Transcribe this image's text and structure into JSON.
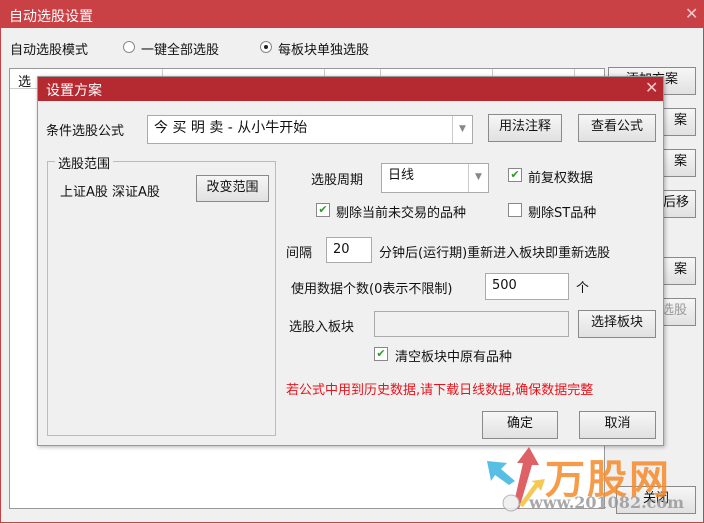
{
  "window": {
    "title": "自动选股设置",
    "close_icon": "close-icon"
  },
  "mode": {
    "label": "自动选股模式",
    "options": [
      {
        "label": "一键全部选股",
        "selected": false
      },
      {
        "label": "每板块单独选股",
        "selected": true
      }
    ]
  },
  "table": {
    "headers": [
      "选"
    ]
  },
  "side_buttons": [
    "添加方案",
    "案",
    "案",
    "后移",
    "案",
    "选股",
    "关闭"
  ],
  "dialog": {
    "title": "设置方案",
    "formula_label": "条件选股公式",
    "formula_value": "今 买 明 卖  - 从小牛开始",
    "usage_button": "用法注释",
    "view_button": "查看公式",
    "range_group": "选股范围",
    "range_value": "上证A股 深证A股",
    "change_range_button": "改变范围",
    "period_label": "选股周期",
    "period_value": "日线",
    "adjust_label": "前复权数据",
    "adjust_checked": true,
    "exclude_untraded_label": "剔除当前未交易的品种",
    "exclude_untraded_checked": true,
    "exclude_st_label": "剔除ST品种",
    "exclude_st_checked": false,
    "interval_label": "间隔",
    "interval_value": "20",
    "interval_suffix": "分钟后(运行期)重新进入板块即重新选股",
    "data_count_label": "使用数据个数(0表示不限制)",
    "data_count_value": "500",
    "data_count_unit": "个",
    "target_block_label": "选股入板块",
    "target_block_value": "",
    "select_block_button": "选择板块",
    "clear_block_label": "清空板块中原有品种",
    "clear_block_checked": true,
    "warning": "若公式中用到历史数据,请下载日线数据,确保数据完整",
    "warning_color": "#e8141c",
    "ok_button": "确定",
    "cancel_button": "取消"
  },
  "watermark": {
    "name": "万股网",
    "url": "www.201082.com"
  }
}
